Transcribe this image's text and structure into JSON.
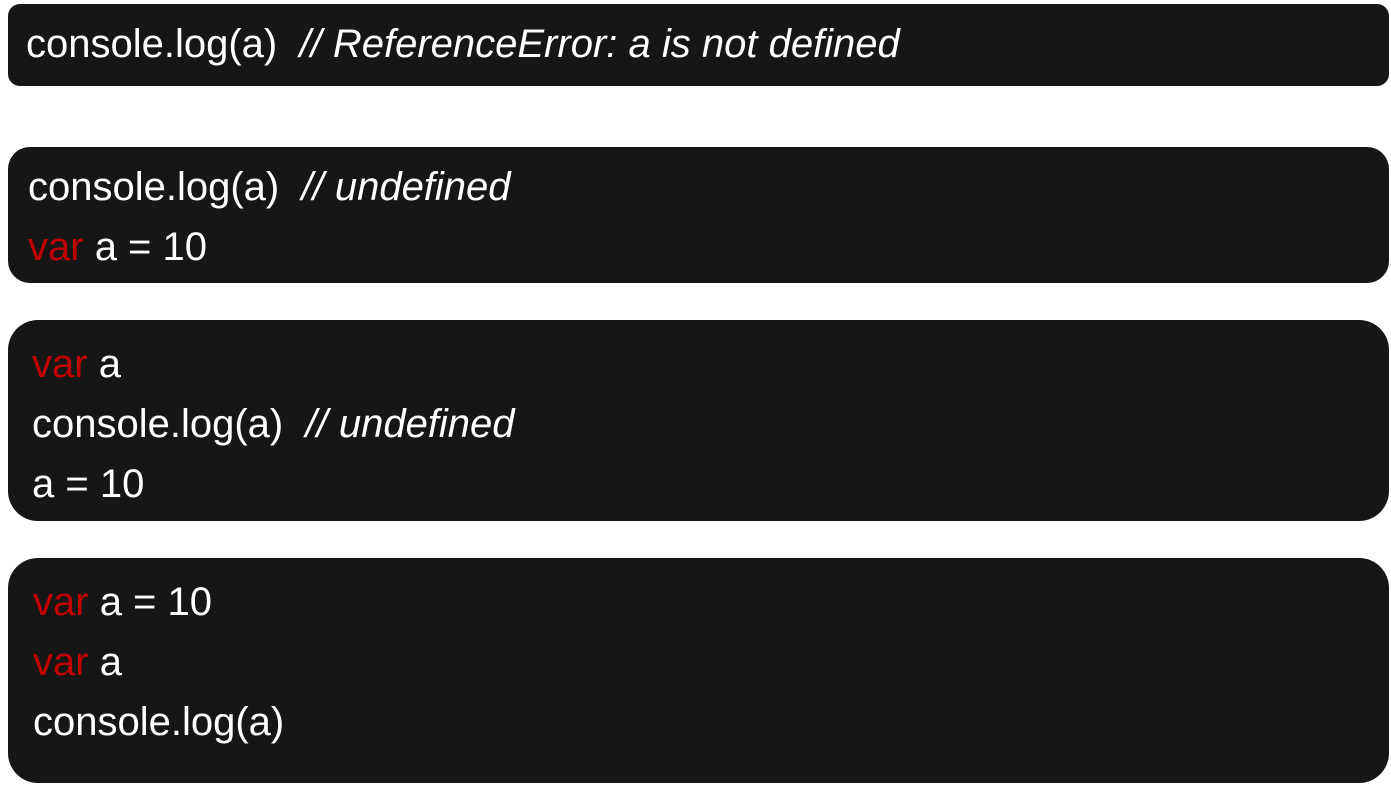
{
  "colors": {
    "background": "#ffffff",
    "block_background": "#161616",
    "text": "#ffffff",
    "keyword": "#c00000"
  },
  "blocks": [
    {
      "lines": [
        {
          "code": "console.log(a)  ",
          "comment": "// ReferenceError: a is not defined"
        }
      ]
    },
    {
      "lines": [
        {
          "code": "console.log(a)  ",
          "comment": "// undefined"
        },
        {
          "keyword": "var",
          "code": " a = 10"
        }
      ]
    },
    {
      "lines": [
        {
          "keyword": "var",
          "code": " a"
        },
        {
          "code": "console.log(a)  ",
          "comment": "// undefined"
        },
        {
          "code": "a = 10"
        }
      ]
    },
    {
      "lines": [
        {
          "keyword": "var",
          "code": " a = 10"
        },
        {
          "keyword": "var",
          "code": " a"
        },
        {
          "code": "console.log(a)"
        }
      ]
    }
  ]
}
